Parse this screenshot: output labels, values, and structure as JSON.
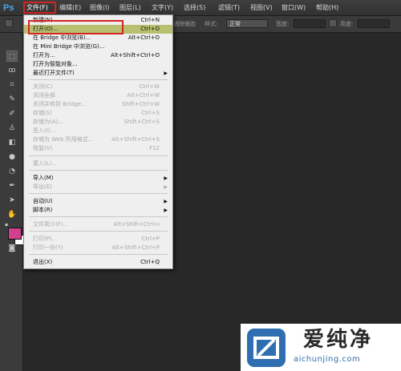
{
  "app": {
    "logo": "Ps"
  },
  "menubar": {
    "items": [
      "文件(F)",
      "编辑(E)",
      "图像(I)",
      "图层(L)",
      "文字(Y)",
      "选择(S)",
      "滤镜(T)",
      "视图(V)",
      "窗口(W)",
      "帮助(H)"
    ]
  },
  "options": {
    "feather": "消除锯齿",
    "style_label": "样式:",
    "style_value": "正常",
    "width_label": "宽度:",
    "height_label": "高度:"
  },
  "file_menu": {
    "items": [
      {
        "label": "新建(N)...",
        "shortcut": "Ctrl+N"
      },
      {
        "label": "打开(O)...",
        "shortcut": "Ctrl+O"
      },
      {
        "label": "在 Bridge 中浏览(B)...",
        "shortcut": "Alt+Ctrl+O"
      },
      {
        "label": "在 Mini Bridge 中浏览(G)...",
        "shortcut": ""
      },
      {
        "label": "打开为...",
        "shortcut": "Alt+Shift+Ctrl+O"
      },
      {
        "label": "打开为智能对象...",
        "shortcut": ""
      },
      {
        "label": "最近打开文件(T)",
        "shortcut": ""
      },
      {
        "label": "关闭(C)",
        "shortcut": "Ctrl+W"
      },
      {
        "label": "关闭全部",
        "shortcut": "Alt+Ctrl+W"
      },
      {
        "label": "关闭并转到 Bridge...",
        "shortcut": "Shift+Ctrl+W"
      },
      {
        "label": "存储(S)",
        "shortcut": "Ctrl+S"
      },
      {
        "label": "存储为(A)...",
        "shortcut": "Shift+Ctrl+S"
      },
      {
        "label": "签入(I)...",
        "shortcut": ""
      },
      {
        "label": "存储为 Web 所用格式...",
        "shortcut": "Alt+Shift+Ctrl+S"
      },
      {
        "label": "恢复(V)",
        "shortcut": "F12"
      },
      {
        "label": "置入(L)...",
        "shortcut": ""
      },
      {
        "label": "导入(M)",
        "shortcut": ""
      },
      {
        "label": "导出(E)",
        "shortcut": ""
      },
      {
        "label": "自动(U)",
        "shortcut": ""
      },
      {
        "label": "脚本(R)",
        "shortcut": ""
      },
      {
        "label": "文件简介(F)...",
        "shortcut": "Alt+Shift+Ctrl+I"
      },
      {
        "label": "打印(P)...",
        "shortcut": "Ctrl+P"
      },
      {
        "label": "打印一份(Y)",
        "shortcut": "Alt+Shift+Ctrl+P"
      },
      {
        "label": "退出(X)",
        "shortcut": "Ctrl+Q"
      }
    ]
  },
  "watermark": {
    "title": "爱纯净",
    "url": "aichunjing.com"
  },
  "colors": {
    "foreground": "#d23f8c",
    "background": "#ffffff",
    "accent": "#d62424"
  }
}
